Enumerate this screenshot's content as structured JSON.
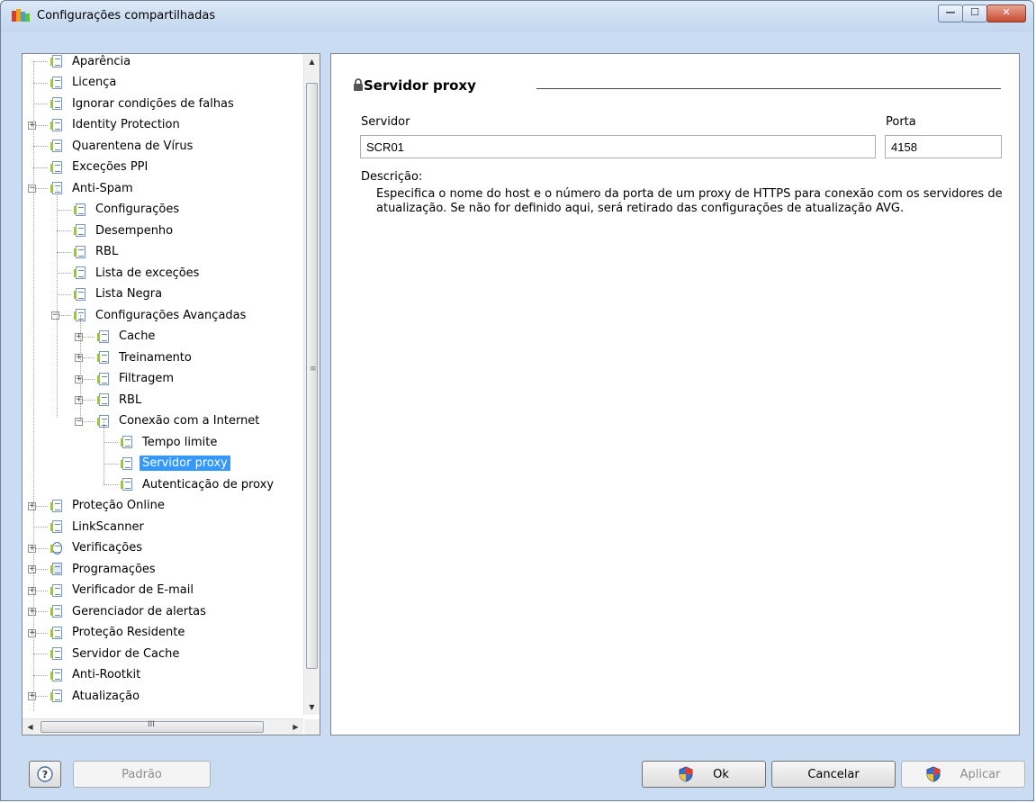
{
  "window": {
    "title": "Configurações compartilhadas",
    "minimize_glyph": "—",
    "maximize_glyph": "☐",
    "close_glyph": "✕"
  },
  "tree": {
    "items": [
      {
        "label": "Aparência",
        "level": 0,
        "expander": ""
      },
      {
        "label": "Licença",
        "level": 0,
        "expander": ""
      },
      {
        "label": "Ignorar condições de falhas",
        "level": 0,
        "expander": ""
      },
      {
        "label": "Identity Protection",
        "level": 0,
        "expander": "+"
      },
      {
        "label": "Quarentena de Vírus",
        "level": 0,
        "expander": ""
      },
      {
        "label": "Exceções PPI",
        "level": 0,
        "expander": ""
      },
      {
        "label": "Anti-Spam",
        "level": 0,
        "expander": "−"
      },
      {
        "label": "Configurações",
        "level": 1,
        "expander": ""
      },
      {
        "label": "Desempenho",
        "level": 1,
        "expander": ""
      },
      {
        "label": "RBL",
        "level": 1,
        "expander": ""
      },
      {
        "label": "Lista de exceções",
        "level": 1,
        "expander": ""
      },
      {
        "label": "Lista Negra",
        "level": 1,
        "expander": ""
      },
      {
        "label": "Configurações Avançadas",
        "level": 1,
        "expander": "−"
      },
      {
        "label": "Cache",
        "level": 2,
        "expander": "+"
      },
      {
        "label": "Treinamento",
        "level": 2,
        "expander": "+"
      },
      {
        "label": "Filtragem",
        "level": 2,
        "expander": "+"
      },
      {
        "label": "RBL",
        "level": 2,
        "expander": "+"
      },
      {
        "label": "Conexão com a Internet",
        "level": 2,
        "expander": "−"
      },
      {
        "label": "Tempo limite",
        "level": 3,
        "expander": ""
      },
      {
        "label": "Servidor proxy",
        "level": 3,
        "expander": "",
        "selected": true
      },
      {
        "label": "Autenticação de proxy",
        "level": 3,
        "expander": ""
      },
      {
        "label": "Proteção Online",
        "level": 0,
        "expander": "+"
      },
      {
        "label": "LinkScanner",
        "level": 0,
        "expander": ""
      },
      {
        "label": "Verificações",
        "level": 0,
        "expander": "+",
        "icon": "magnifier-icon"
      },
      {
        "label": "Programações",
        "level": 0,
        "expander": "+",
        "icon": "schedule-icon"
      },
      {
        "label": "Verificador de E-mail",
        "level": 0,
        "expander": "+"
      },
      {
        "label": "Gerenciador de alertas",
        "level": 0,
        "expander": "+"
      },
      {
        "label": "Proteção Residente",
        "level": 0,
        "expander": "+"
      },
      {
        "label": "Servidor de Cache",
        "level": 0,
        "expander": ""
      },
      {
        "label": "Anti-Rootkit",
        "level": 0,
        "expander": ""
      },
      {
        "label": "Atualização",
        "level": 0,
        "expander": "+"
      }
    ],
    "vscroll_grip": "≡",
    "hscroll_grip": "III",
    "up_arrow": "▲",
    "down_arrow": "▼",
    "left_arrow": "◀",
    "right_arrow": "▶"
  },
  "panel": {
    "title": "Servidor proxy",
    "server_label": "Servidor",
    "server_value": "SCR01",
    "port_label": "Porta",
    "port_value": "4158",
    "description_label": "Descrição:",
    "description_text": "Especifica o nome do host e o número da porta de um proxy de HTTPS para conexão com os servidores de atualização. Se não for definido aqui, será retirado das configurações de atualização AVG."
  },
  "buttons": {
    "help": "?",
    "default": "Padrão",
    "ok": "Ok",
    "cancel": "Cancelar",
    "apply": "Aplicar"
  },
  "colors": {
    "selection": "#3399ff",
    "titlebar": "#c9dcf1"
  }
}
